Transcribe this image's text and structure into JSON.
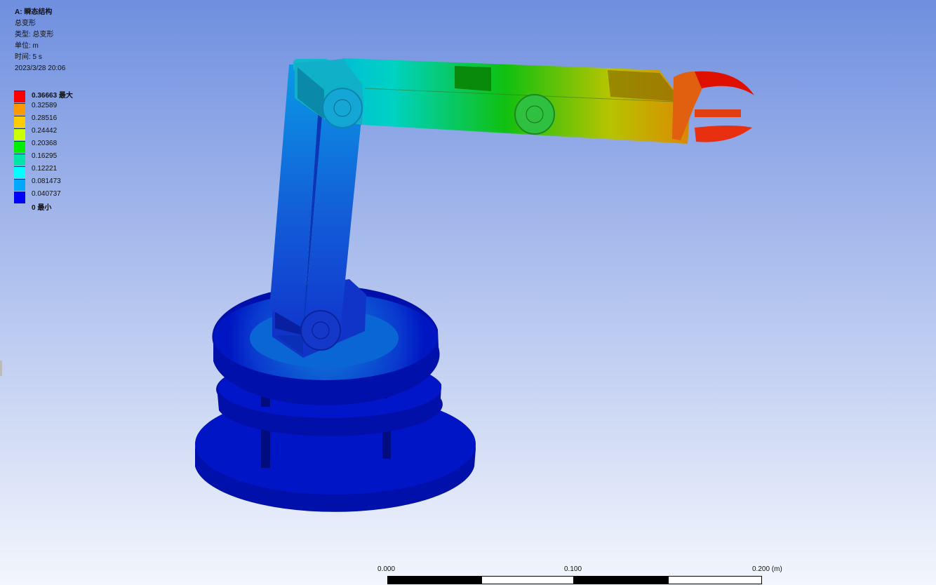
{
  "info": {
    "analysis": "A: 瞬态结构",
    "result": "总变形",
    "type": "类型: 总变形",
    "unit": "单位: m",
    "time": "时间: 5 s",
    "date": "2023/3/28 20:06"
  },
  "legend": {
    "entries": [
      {
        "label": "0.36663 最大",
        "color": "#ff0000",
        "bold": true
      },
      {
        "label": "0.32589",
        "color": "#ff9900",
        "bold": false
      },
      {
        "label": "0.28516",
        "color": "#ffcc00",
        "bold": false
      },
      {
        "label": "0.24442",
        "color": "#ccff00",
        "bold": false
      },
      {
        "label": "0.20368",
        "color": "#00ee00",
        "bold": false
      },
      {
        "label": "0.16295",
        "color": "#00e4aa",
        "bold": false
      },
      {
        "label": "0.12221",
        "color": "#00ffff",
        "bold": false
      },
      {
        "label": "0.081473",
        "color": "#00a8ff",
        "bold": false
      },
      {
        "label": "0.040737",
        "color": "#0000ff",
        "bold": false
      },
      {
        "label": "0 最小",
        "color": "",
        "bold": true
      }
    ]
  },
  "scale_bar": {
    "labels": [
      "0.000",
      "0.100",
      "0.200 (m)"
    ]
  }
}
